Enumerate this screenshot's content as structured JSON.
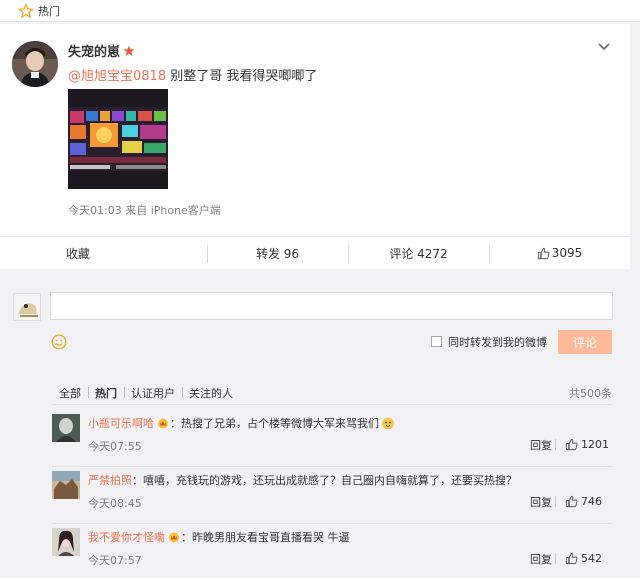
{
  "topbar": {
    "label": "热门",
    "icon": "star-icon"
  },
  "post": {
    "username": "失宠的崽",
    "mention": "@旭旭宝宝0818",
    "text": " 别整了哥 我看得哭唧唧了",
    "time": "今天01:03",
    "source": "来自 iPhone客户端",
    "accent": "#eb7350"
  },
  "actions": {
    "favorite": "收藏",
    "repost": "转发 96",
    "comment": "评论 4272",
    "like": "3095"
  },
  "composer": {
    "placeholder": "",
    "repost_label": "同时转发到我的微博",
    "submit_label": "评论"
  },
  "filters": {
    "items": [
      "全部",
      "热门",
      "认证用户",
      "关注的人"
    ],
    "count": "共500条"
  },
  "comments": [
    {
      "name": "小瓶可乐啊哈",
      "text": "：热搜了兄弟，占个楼等微博大军来骂我们",
      "time": "今天07:55",
      "reply": "回复",
      "likes": "1201"
    },
    {
      "name": "严禁拍照",
      "text": "：嘻嘻，充钱玩的游戏，还玩出成就感了？自己圈内自嗨就算了，还要买热搜？",
      "time": "今天08:45",
      "reply": "回复",
      "likes": "746"
    },
    {
      "name": "我不爱你才怪嘞",
      "text": "：昨晚男朋友看宝哥直播看哭 牛逼",
      "time": "今天07:57",
      "reply": "回复",
      "likes": "542"
    }
  ]
}
